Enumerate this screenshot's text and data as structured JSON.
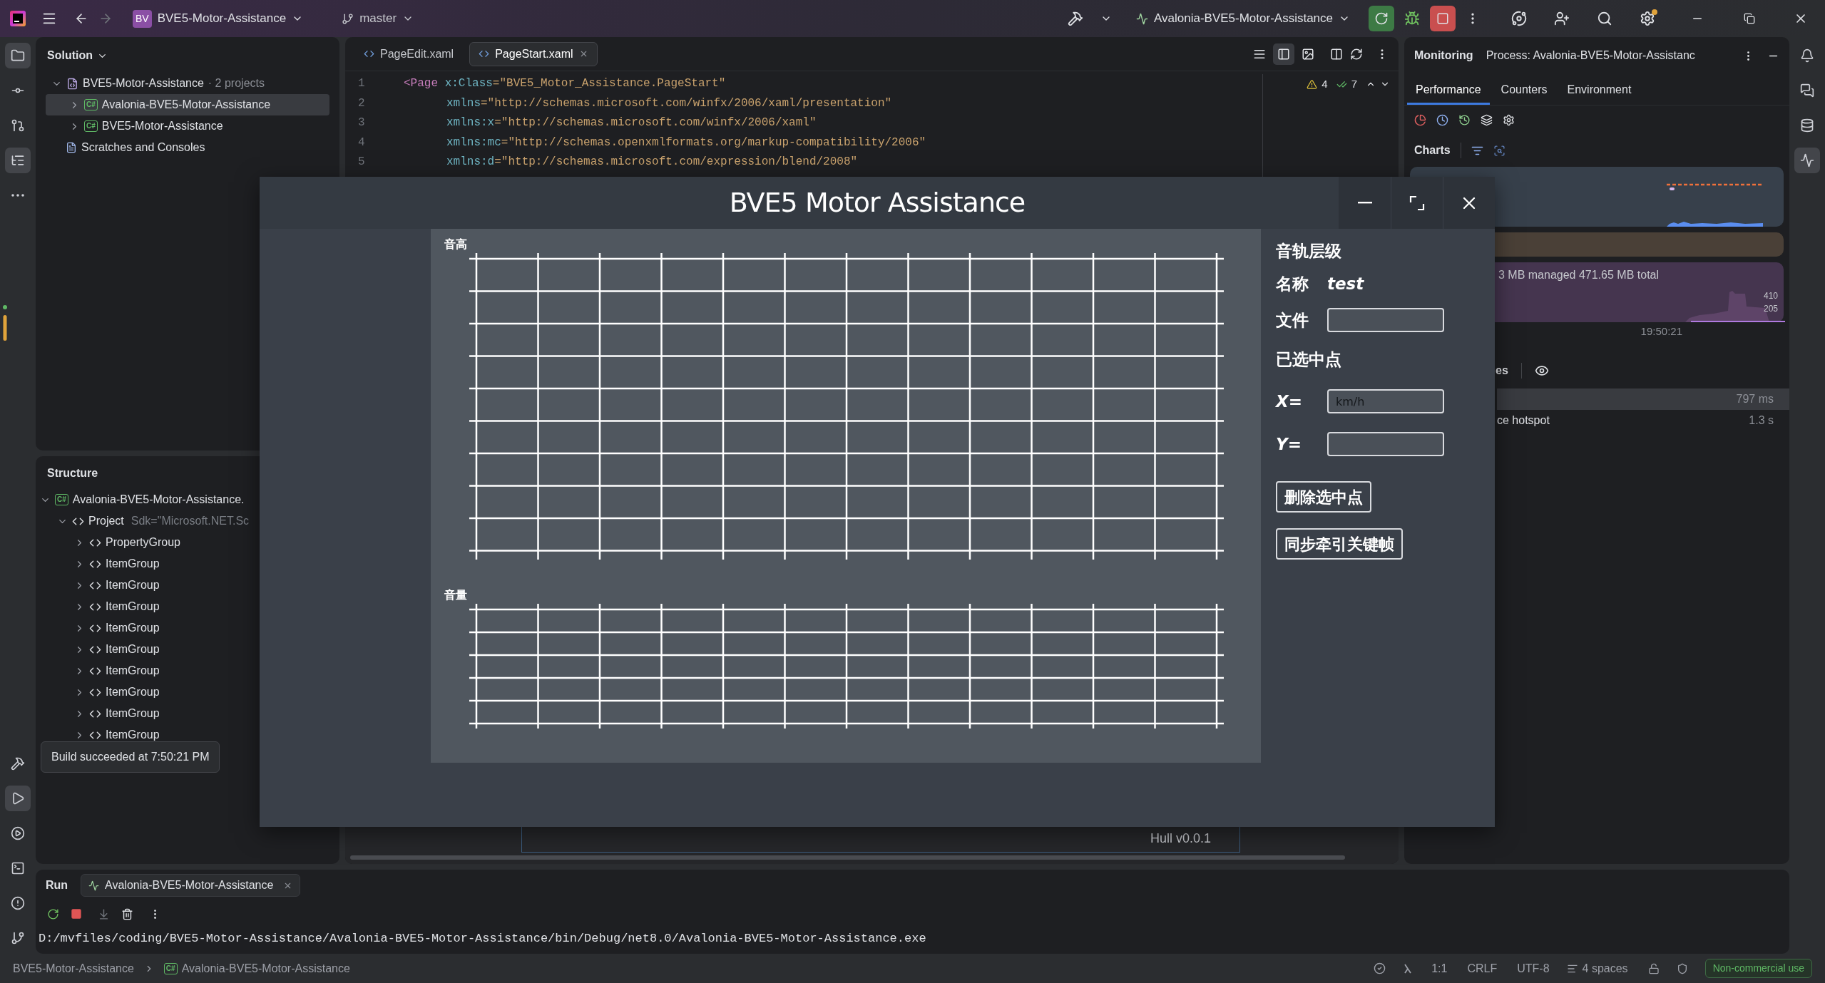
{
  "title_bar": {
    "project_badge": "BV",
    "project": "BVE5-Motor-Assistance",
    "branch": "master",
    "run_config": "Avalonia-BVE5-Motor-Assistance",
    "forward_enabled": false,
    "settings_badge": true
  },
  "left_toolbar": {
    "top": [
      {
        "selected": true
      },
      {
        "selected": false
      },
      {
        "selected": false
      },
      {
        "selected": true
      },
      {
        "selected": false
      }
    ],
    "bottom": [
      {
        "selected": false
      },
      {
        "selected": true
      },
      {
        "selected": false
      },
      {
        "selected": false
      },
      {
        "selected": false
      },
      {
        "selected": false
      }
    ]
  },
  "right_toolbar": [
    {
      "selected": false
    },
    {
      "selected": false
    },
    {
      "selected": false
    },
    {
      "selected": true
    }
  ],
  "solution": {
    "title": "Solution",
    "tree": {
      "kind": "solution",
      "label": "BVE5-Motor-Assistance",
      "note": "· 2 projects",
      "expanded": true,
      "selected": false,
      "children": [
        {
          "kind": "project",
          "badge": "C#",
          "label": "Avalonia-BVE5-Motor-Assistance",
          "expanded": false,
          "selected": true
        },
        {
          "kind": "project",
          "badge": "C#",
          "label": "BVE5-Motor-Assistance",
          "expanded": false,
          "selected": false
        }
      ]
    },
    "scratches": "Scratches and Consoles"
  },
  "structure": {
    "title": "Structure",
    "tree": {
      "kind": "project",
      "badge": "C#",
      "label": "Avalonia-BVE5-Motor-Assistance.",
      "expanded": true,
      "children": [
        {
          "kind": "element",
          "label": "Project",
          "attr": "Sdk=\"Microsoft.NET.Sc",
          "expanded": true,
          "children": [
            {
              "kind": "element",
              "label": "PropertyGroup",
              "expanded": false
            },
            {
              "kind": "element",
              "label": "ItemGroup",
              "expanded": false
            },
            {
              "kind": "element",
              "label": "ItemGroup",
              "expanded": false
            },
            {
              "kind": "element",
              "label": "ItemGroup",
              "expanded": false
            },
            {
              "kind": "element",
              "label": "ItemGroup",
              "expanded": false
            },
            {
              "kind": "element",
              "label": "ItemGroup",
              "expanded": false
            },
            {
              "kind": "element",
              "label": "ItemGroup",
              "expanded": false
            },
            {
              "kind": "element",
              "label": "ItemGroup",
              "expanded": false
            },
            {
              "kind": "element",
              "label": "ItemGroup",
              "expanded": false
            },
            {
              "kind": "element",
              "label": "ItemGroup",
              "expanded": false
            }
          ]
        }
      ]
    }
  },
  "build_tooltip": "Build succeeded at 7:50:21 PM",
  "editor": {
    "tabs": [
      {
        "label": "PageEdit.xaml",
        "selected": false
      },
      {
        "label": "PageStart.xaml",
        "selected": true
      }
    ],
    "warnings": "4",
    "checks": "7",
    "lines": [
      {
        "number": "1",
        "tag": "<Page",
        "attr": "x:Class",
        "value": "=\"BVE5_Motor_Assistance.PageStart\""
      },
      {
        "number": "2",
        "attr": "xmlns",
        "value": "=\"http://schemas.microsoft.com/winfx/2006/xaml/presentation\""
      },
      {
        "number": "3",
        "attr": "xmlns:x",
        "value": "=\"http://schemas.microsoft.com/winfx/2006/xaml\""
      },
      {
        "number": "4",
        "attr": "xmlns:mc",
        "value": "=\"http://schemas.openxmlformats.org/markup-compatibility/2006\""
      },
      {
        "number": "5",
        "attr": "xmlns:d",
        "value": "=\"http://schemas.microsoft.com/expression/blend/2008\""
      }
    ],
    "preview_text": "Hull v0.0.1"
  },
  "monitoring": {
    "title": "Monitoring",
    "process": "Process: Avalonia-BVE5-Motor-Assistanc",
    "tabs": [
      {
        "label": "Performance",
        "selected": true
      },
      {
        "label": "Counters",
        "selected": false
      },
      {
        "label": "Environment",
        "selected": false
      }
    ],
    "charts_title": "Charts",
    "memory": "3 MB managed  471.65 MB total",
    "memory_ticks": [
      "410",
      "205"
    ],
    "time": "19:50:21",
    "section": "es",
    "rows": [
      {
        "value": "797 ms",
        "selected": true
      },
      {
        "label": "ce hotspot",
        "value": "1.3 s",
        "selected": false
      }
    ]
  },
  "app_window": {
    "title": "BVE5 Motor Assistance",
    "charts": [
      {
        "label": "音高"
      },
      {
        "label": "音量"
      }
    ],
    "panel": {
      "heading": "音轨层级",
      "name_label": "名称",
      "name_value": "test",
      "file_label": "文件",
      "selected_heading": "已选中点",
      "x_label": "X=",
      "x_placeholder": "km/h",
      "y_label": "Y=",
      "buttons": [
        "删除选中点",
        "同步牵引关键帧"
      ]
    }
  },
  "run_panel": {
    "title": "Run",
    "tab": "Avalonia-BVE5-Motor-Assistance",
    "output": "D:/mvfiles/coding/BVE5-Motor-Assistance/Avalonia-BVE5-Motor-Assistance/bin/Debug/net8.0/Avalonia-BVE5-Motor-Assistance.exe"
  },
  "status_bar": {
    "breadcrumb": [
      {
        "label": "BVE5-Motor-Assistance"
      },
      {
        "badge": "C#",
        "label": "Avalonia-BVE5-Motor-Assistance"
      }
    ],
    "position": "1:1",
    "line_ending": "CRLF",
    "encoding": "UTF-8",
    "indent": "4 spaces",
    "license": "Non-commercial use"
  }
}
